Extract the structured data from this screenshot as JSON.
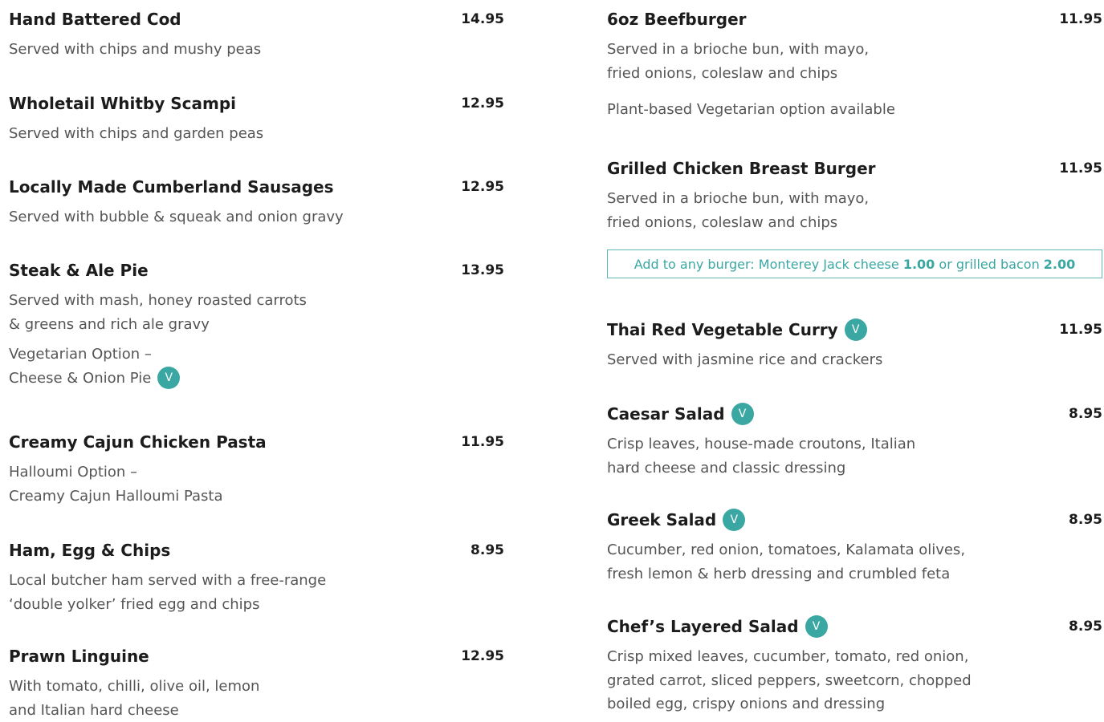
{
  "left": {
    "items": [
      {
        "name": "Hand Battered Cod",
        "price": "14.95",
        "desc": [
          "Served with chips and mushy peas"
        ]
      },
      {
        "name": "Wholetail Whitby Scampi",
        "price": "12.95",
        "desc": [
          "Served with chips and garden peas"
        ]
      },
      {
        "name": "Locally Made Cumberland Sausages",
        "price": "12.95",
        "desc": [
          "Served with bubble & squeak and onion gravy"
        ]
      },
      {
        "name": "Steak & Ale Pie",
        "price": "13.95",
        "desc": [
          "Served with mash, honey roasted carrots",
          "& greens and rich ale gravy"
        ],
        "note": [
          "Vegetarian Option –",
          "Cheese & Onion Pie"
        ]
      },
      {
        "name": "Creamy Cajun Chicken Pasta",
        "price": "11.95",
        "desc": [
          "Halloumi Option –",
          "Creamy Cajun Halloumi Pasta"
        ]
      },
      {
        "name": "Ham, Egg & Chips",
        "price": "8.95",
        "desc": [
          "Local butcher ham served with a free-range",
          "‘double yolker’ fried egg and chips"
        ]
      },
      {
        "name": "Prawn Linguine",
        "price": "12.95",
        "desc": [
          "With tomato, chilli, olive oil, lemon",
          "and Italian hard cheese"
        ]
      }
    ]
  },
  "right": {
    "items": [
      {
        "name": "6oz Beefburger",
        "price": "11.95",
        "desc": [
          "Served in a brioche bun, with mayo,",
          "fried onions, coleslaw and chips"
        ],
        "note": [
          "Plant-based Vegetarian option available"
        ]
      },
      {
        "name": "Grilled Chicken Breast Burger",
        "price": "11.95",
        "desc": [
          "Served in a brioche bun, with mayo,",
          "fried onions, coleslaw and chips"
        ]
      },
      {
        "name": "Thai Red Vegetable Curry",
        "price": "11.95",
        "desc": [
          "Served with jasmine rice and crackers"
        ]
      },
      {
        "name": "Caesar Salad",
        "price": "8.95",
        "desc": [
          "Crisp leaves, house-made croutons, Italian",
          "hard cheese and classic dressing"
        ]
      },
      {
        "name": "Greek Salad",
        "price": "8.95",
        "desc": [
          "Cucumber, red onion, tomatoes, Kalamata olives,",
          "fresh lemon & herb dressing and crumbled feta"
        ]
      },
      {
        "name": "Chef’s Layered Salad",
        "price": "8.95",
        "desc": [
          "Crisp mixed leaves, cucumber, tomato, red onion,",
          "grated carrot, sliced peppers, sweetcorn, chopped",
          "boiled egg, crispy onions and dressing"
        ]
      }
    ],
    "addon": {
      "prefix": "Add to any burger: Monterey Jack cheese",
      "price1": "1.00",
      "middle": "or grilled bacon",
      "price2": "2.00"
    }
  },
  "badge": {
    "label": "V",
    "color": "#3aa7a3"
  }
}
